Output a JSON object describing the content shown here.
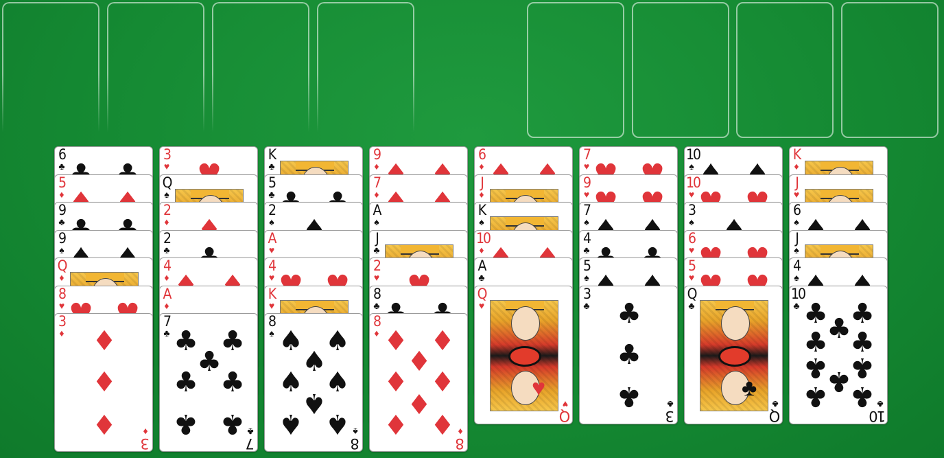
{
  "game": "FreeCell",
  "colors": {
    "felt": "#158a33",
    "red": "#e0353a",
    "black": "#111111"
  },
  "free_cells": [
    "",
    "",
    "",
    ""
  ],
  "foundations": [
    "",
    "",
    "",
    ""
  ],
  "columns": [
    {
      "cards": [
        {
          "rank": "6",
          "suit": "♣"
        },
        {
          "rank": "5",
          "suit": "♦"
        },
        {
          "rank": "9",
          "suit": "♣"
        },
        {
          "rank": "9",
          "suit": "♠"
        },
        {
          "rank": "Q",
          "suit": "♦"
        },
        {
          "rank": "8",
          "suit": "♥"
        },
        {
          "rank": "3",
          "suit": "♦"
        }
      ]
    },
    {
      "cards": [
        {
          "rank": "3",
          "suit": "♥"
        },
        {
          "rank": "Q",
          "suit": "♠"
        },
        {
          "rank": "2",
          "suit": "♦"
        },
        {
          "rank": "2",
          "suit": "♣"
        },
        {
          "rank": "4",
          "suit": "♦"
        },
        {
          "rank": "A",
          "suit": "♦"
        },
        {
          "rank": "7",
          "suit": "♣"
        }
      ]
    },
    {
      "cards": [
        {
          "rank": "K",
          "suit": "♣"
        },
        {
          "rank": "5",
          "suit": "♣"
        },
        {
          "rank": "2",
          "suit": "♠"
        },
        {
          "rank": "A",
          "suit": "♥"
        },
        {
          "rank": "4",
          "suit": "♥"
        },
        {
          "rank": "K",
          "suit": "♥"
        },
        {
          "rank": "8",
          "suit": "♠"
        }
      ]
    },
    {
      "cards": [
        {
          "rank": "9",
          "suit": "♦"
        },
        {
          "rank": "7",
          "suit": "♦"
        },
        {
          "rank": "A",
          "suit": "♠"
        },
        {
          "rank": "J",
          "suit": "♣"
        },
        {
          "rank": "2",
          "suit": "♥"
        },
        {
          "rank": "8",
          "suit": "♣"
        },
        {
          "rank": "8",
          "suit": "♦"
        }
      ]
    },
    {
      "cards": [
        {
          "rank": "6",
          "suit": "♦"
        },
        {
          "rank": "J",
          "suit": "♦"
        },
        {
          "rank": "K",
          "suit": "♠"
        },
        {
          "rank": "10",
          "suit": "♦"
        },
        {
          "rank": "A",
          "suit": "♣"
        },
        {
          "rank": "Q",
          "suit": "♥"
        }
      ]
    },
    {
      "cards": [
        {
          "rank": "7",
          "suit": "♥"
        },
        {
          "rank": "9",
          "suit": "♥"
        },
        {
          "rank": "7",
          "suit": "♠"
        },
        {
          "rank": "4",
          "suit": "♣"
        },
        {
          "rank": "5",
          "suit": "♠"
        },
        {
          "rank": "3",
          "suit": "♣"
        }
      ]
    },
    {
      "cards": [
        {
          "rank": "10",
          "suit": "♠"
        },
        {
          "rank": "10",
          "suit": "♥"
        },
        {
          "rank": "3",
          "suit": "♠"
        },
        {
          "rank": "6",
          "suit": "♥"
        },
        {
          "rank": "5",
          "suit": "♥"
        },
        {
          "rank": "Q",
          "suit": "♣"
        }
      ]
    },
    {
      "cards": [
        {
          "rank": "K",
          "suit": "♦"
        },
        {
          "rank": "J",
          "suit": "♥"
        },
        {
          "rank": "6",
          "suit": "♠"
        },
        {
          "rank": "J",
          "suit": "♠"
        },
        {
          "rank": "4",
          "suit": "♠"
        },
        {
          "rank": "10",
          "suit": "♣"
        }
      ]
    }
  ]
}
